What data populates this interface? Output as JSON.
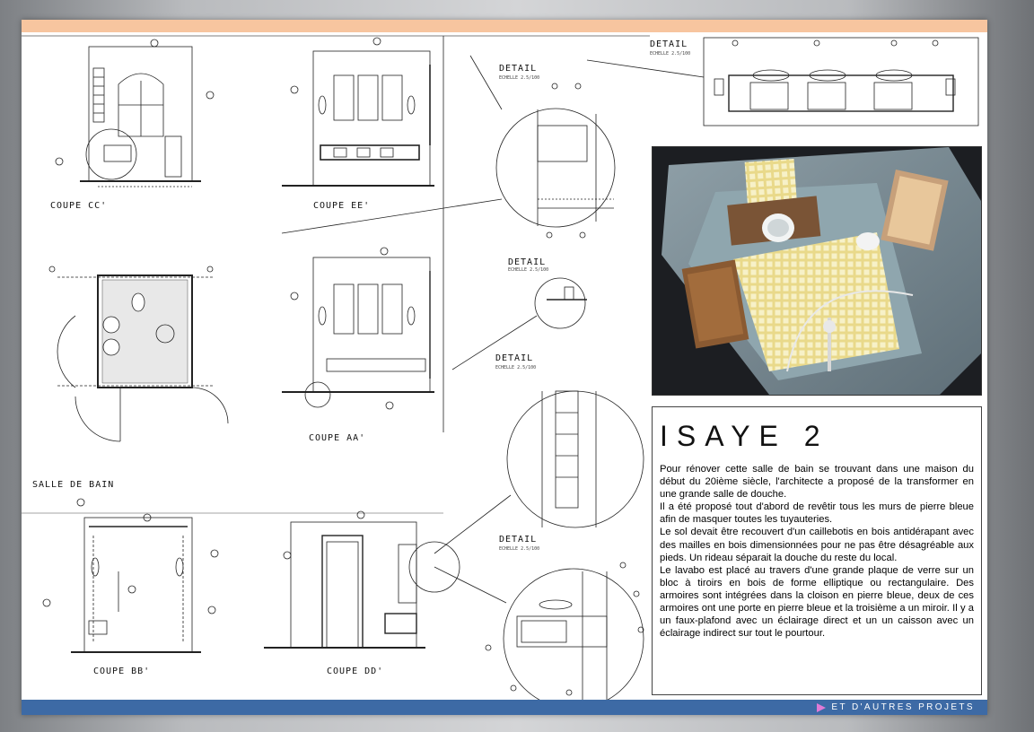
{
  "project": {
    "title": "ISAYE 2",
    "paragraphs": [
      "Pour rénover cette salle de bain se trouvant dans une maison du début du 20ième siècle, l'architecte a proposé de la transformer en une grande salle de douche.",
      "Il a été proposé tout d'abord de revêtir tous les murs de pierre bleue afin de masquer toutes les tuyauteries.",
      "Le sol devait être recouvert d'un caillebotis en bois antidérapant avec des mailles en bois dimensionnées pour ne pas être désagréable aux pieds. Un rideau séparait la douche du reste du local.",
      "Le lavabo est placé au travers d'une grande plaque de verre sur un bloc à tiroirs en bois de forme elliptique ou rectangulaire. Des armoires sont intégrées dans la cloison en pierre bleue, deux de ces armoires ont une porte en pierre bleue et la troisième a un miroir. Il y a un faux-plafond avec un éclairage direct et un un caisson avec un éclairage indirect sur tout le pourtour."
    ]
  },
  "footer": {
    "link_label": "ET D'AUTRES PROJETS"
  },
  "drawings": {
    "coupe_cc": "COUPE CC'",
    "coupe_ee": "COUPE EE'",
    "coupe_aa": "COUPE AA'",
    "coupe_bb": "COUPE BB'",
    "coupe_dd": "COUPE DD'",
    "plan": "SALLE DE BAIN",
    "detail_1": "DETAIL",
    "detail_2": "DETAIL",
    "detail_3": "DETAIL",
    "detail_4": "DETAIL",
    "detail_5": "DETAIL",
    "scale": "ECHELLE 2.5/100"
  },
  "colors": {
    "top_band": "#f7c59f",
    "bottom_band": "#3d6aa5",
    "footer_arrow": "#e07ad6"
  }
}
